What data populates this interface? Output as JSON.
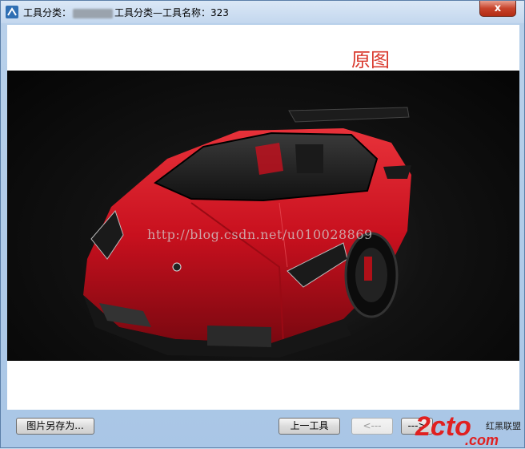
{
  "window": {
    "title_prefix": "工具分类：",
    "title_suffix": "工具分类—工具名称：323",
    "close_label": "x"
  },
  "content": {
    "caption": "原图",
    "watermark": "http://blog.csdn.net/u010028869"
  },
  "buttons": {
    "save_as": "图片另存为...",
    "prev_tool": "上一工具",
    "prev_image": "<---",
    "next_image": "--->"
  },
  "site_logo": {
    "brand": "2cto",
    "domain": ".com",
    "tagline": "红黑联盟"
  },
  "colors": {
    "caption": "#d93a2e",
    "car_body": "#c8101e",
    "logo_red": "#e02020"
  }
}
